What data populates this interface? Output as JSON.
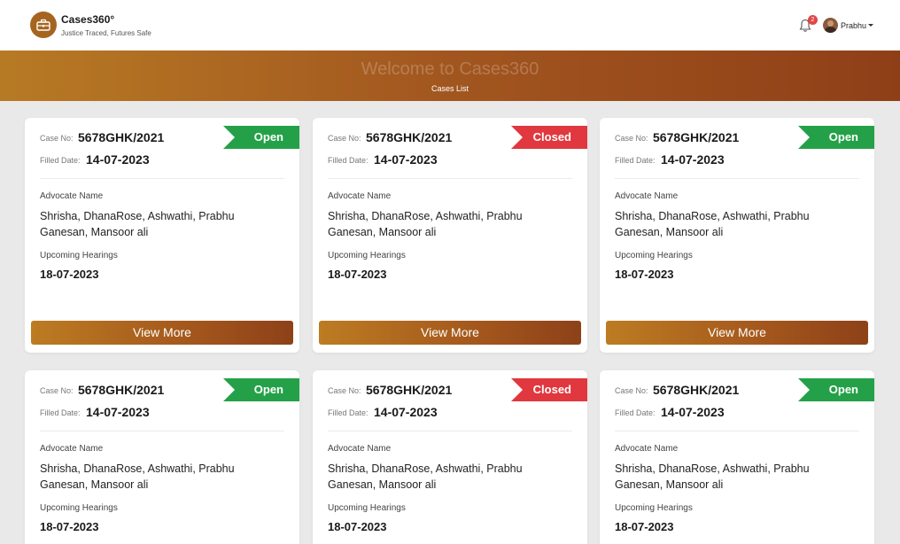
{
  "brand": {
    "title": "Cases360°",
    "tagline": "Justice Traced, Futures Safe"
  },
  "header": {
    "notification_count": "2",
    "user_name": "Prabhu"
  },
  "banner": {
    "title": "Welcome to Cases360",
    "subtitle": "Cases List"
  },
  "labels": {
    "case_no": "Case No:",
    "filled_date": "Filled Date:",
    "advocate_name": "Advocate Name",
    "upcoming_hearings": "Upcoming Hearings",
    "view_more": "View More"
  },
  "colors": {
    "open": "#24a148",
    "closed": "#e0383e",
    "accent": "#a2561f"
  },
  "cards": [
    {
      "case_no": "5678GHK/2021",
      "filled_date": "14-07-2023",
      "status": "Open",
      "advocates": "Shrisha, DhanaRose, Ashwathi, Prabhu Ganesan, Mansoor ali",
      "hearing_date": "18-07-2023"
    },
    {
      "case_no": "5678GHK/2021",
      "filled_date": "14-07-2023",
      "status": "Closed",
      "advocates": "Shrisha, DhanaRose, Ashwathi, Prabhu Ganesan, Mansoor ali",
      "hearing_date": "18-07-2023"
    },
    {
      "case_no": "5678GHK/2021",
      "filled_date": "14-07-2023",
      "status": "Open",
      "advocates": "Shrisha, DhanaRose, Ashwathi, Prabhu Ganesan, Mansoor ali",
      "hearing_date": "18-07-2023"
    },
    {
      "case_no": "5678GHK/2021",
      "filled_date": "14-07-2023",
      "status": "Open",
      "advocates": "Shrisha, DhanaRose, Ashwathi, Prabhu Ganesan, Mansoor ali",
      "hearing_date": "18-07-2023"
    },
    {
      "case_no": "5678GHK/2021",
      "filled_date": "14-07-2023",
      "status": "Closed",
      "advocates": "Shrisha, DhanaRose, Ashwathi, Prabhu Ganesan, Mansoor ali",
      "hearing_date": "18-07-2023"
    },
    {
      "case_no": "5678GHK/2021",
      "filled_date": "14-07-2023",
      "status": "Open",
      "advocates": "Shrisha, DhanaRose, Ashwathi, Prabhu Ganesan, Mansoor ali",
      "hearing_date": "18-07-2023"
    }
  ]
}
